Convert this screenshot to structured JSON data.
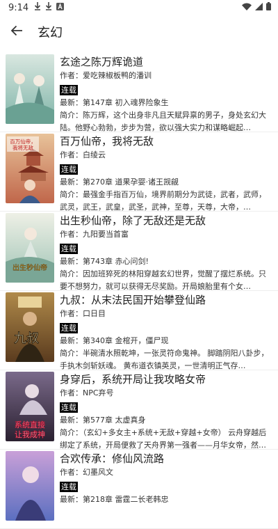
{
  "status_bar": {
    "time": "9:14",
    "left_icons": [
      "download-icon",
      "download-icon",
      "app-a-icon"
    ],
    "right_icons": [
      "wifi-icon",
      "signal-icon",
      "battery-icon"
    ]
  },
  "header": {
    "title": "玄幻"
  },
  "books": [
    {
      "title": "玄途之陈万辉诡道",
      "author": "作者：爱吃辣椒板鸭的潘训",
      "status": "连载",
      "latest": "最新：第147章 初入魂界险象生",
      "summary": "简介：陈万辉，这个出身非凡且天赋异禀的男子，身处玄幻大陆。他野心勃勃，步步为营，欲以强大实力和谋略崛起…",
      "cover_colors": [
        "#7fb4a8",
        "#d9e7e0"
      ]
    },
    {
      "title": "百万仙帝，我将无敌",
      "author": "作者：白绫云",
      "status": "连载",
      "latest": "最新：第270章 道果孕婴·诸王觊觎",
      "summary": "简介：最强金手指百万仙，境界前期分为武徒，武者，武师，武灵，武王，武皇，武圣，武神，至尊，天尊，大帝，…",
      "cover_colors": [
        "#c0664a",
        "#e8c39a"
      ],
      "cover_text": "百万仙帝，我将无敌"
    },
    {
      "title": "出生秒仙帝，除了无敌还是无敌",
      "author": "作者：九阳要当首富",
      "status": "连载",
      "latest": "最新：第743章 赤心问剑!",
      "summary": "简介：因加班猝死的林阳穿越玄幻世界，觉醒了摆烂系统。只要不想努力，就可以获得无尽奖励。开局娘胎里有个女…",
      "cover_colors": [
        "#9fc3b5",
        "#eef0e6"
      ],
      "cover_text": "出生秒仙帝"
    },
    {
      "title": "九叔：从末法民国开始攀登仙路",
      "author": "作者：口日目",
      "status": "连载",
      "latest": "最新：第340章 金棺开，僵尸现",
      "summary": "简介：半碗清水照乾坤，一张灵符命鬼神。 脚踏阴阳八卦步，手执木剑斩妖魂。 黄布道衣镇英灵，一世清明正气存…",
      "cover_colors": [
        "#5a3b1e",
        "#b08a4a"
      ],
      "cover_text": "九叔"
    },
    {
      "title": "身穿后，系统开局让我攻略女帝",
      "author": "作者：NPC弃号",
      "status": "连载",
      "latest": "最新：第577章 太虚真身",
      "summary": "简介：（玄幻+多女主+系统+无敌+穿越+女帝） 云舟穿越后绑定了系统，开局便救了天舟界第一强者——月华女帝，然…",
      "cover_colors": [
        "#2a2030",
        "#7a6a8a"
      ],
      "cover_text": "系统直接让我成神"
    },
    {
      "title": "合欢传承：修仙风流路",
      "author": "作者：幻墨风文",
      "status": "连载",
      "latest": "最新：第218章 雷霆二长老韩忠",
      "summary": "",
      "cover_colors": [
        "#5b6fc0",
        "#c9a0d8"
      ]
    }
  ]
}
